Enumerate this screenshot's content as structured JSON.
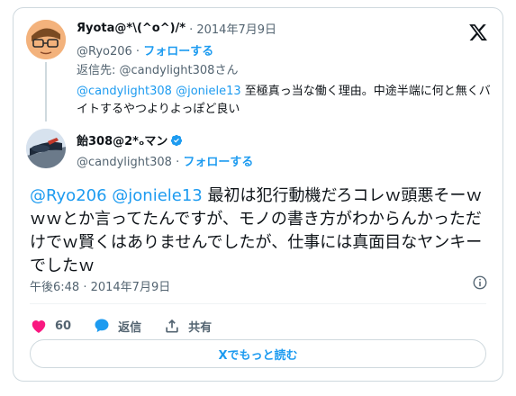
{
  "quoted_tweet": {
    "display_name": "Яyota@*\\(^o^)/*",
    "date": "· 2014年7月9日",
    "handle": "@Ryo206",
    "separator": " · ",
    "follow_label": "フォローする",
    "reply_to_prefix": "返信先: ",
    "reply_to_handle": "@candylight308さん",
    "text_mention_1": "@candylight308",
    "text_mention_2": "@joniele13",
    "text_body": " 至極真っ当な働く理由。中途半端に何と無くバイトするやつよりよっぽど良い"
  },
  "main_tweet": {
    "display_name": "飴308@2*ₒマン",
    "handle": "@candylight308",
    "separator": " · ",
    "follow_label": "フォローする",
    "text_mention_1": "@Ryo206",
    "text_mention_2": "@joniele13",
    "text_body": " 最初は犯行動機だろコレｗ頭悪そーｗｗｗとか言ってたんですが、モノの書き方がわからんかっただけでｗ賢くはありませんでしたが、仕事には真面目なヤンキーでしたｗ",
    "date": "午後6:48 · 2014年7月9日"
  },
  "actions": {
    "like_count": "60",
    "reply_label": "返信",
    "share_label": "共有"
  },
  "read_more_label": "Xでもっと読む",
  "colors": {
    "accent": "#1d9bf0",
    "like": "#f91880",
    "secondary_text": "#536471",
    "border": "#cfd9de"
  },
  "icons": [
    "x-logo-icon",
    "verified-badge-icon",
    "info-icon",
    "heart-icon",
    "reply-bubble-icon",
    "share-icon"
  ]
}
